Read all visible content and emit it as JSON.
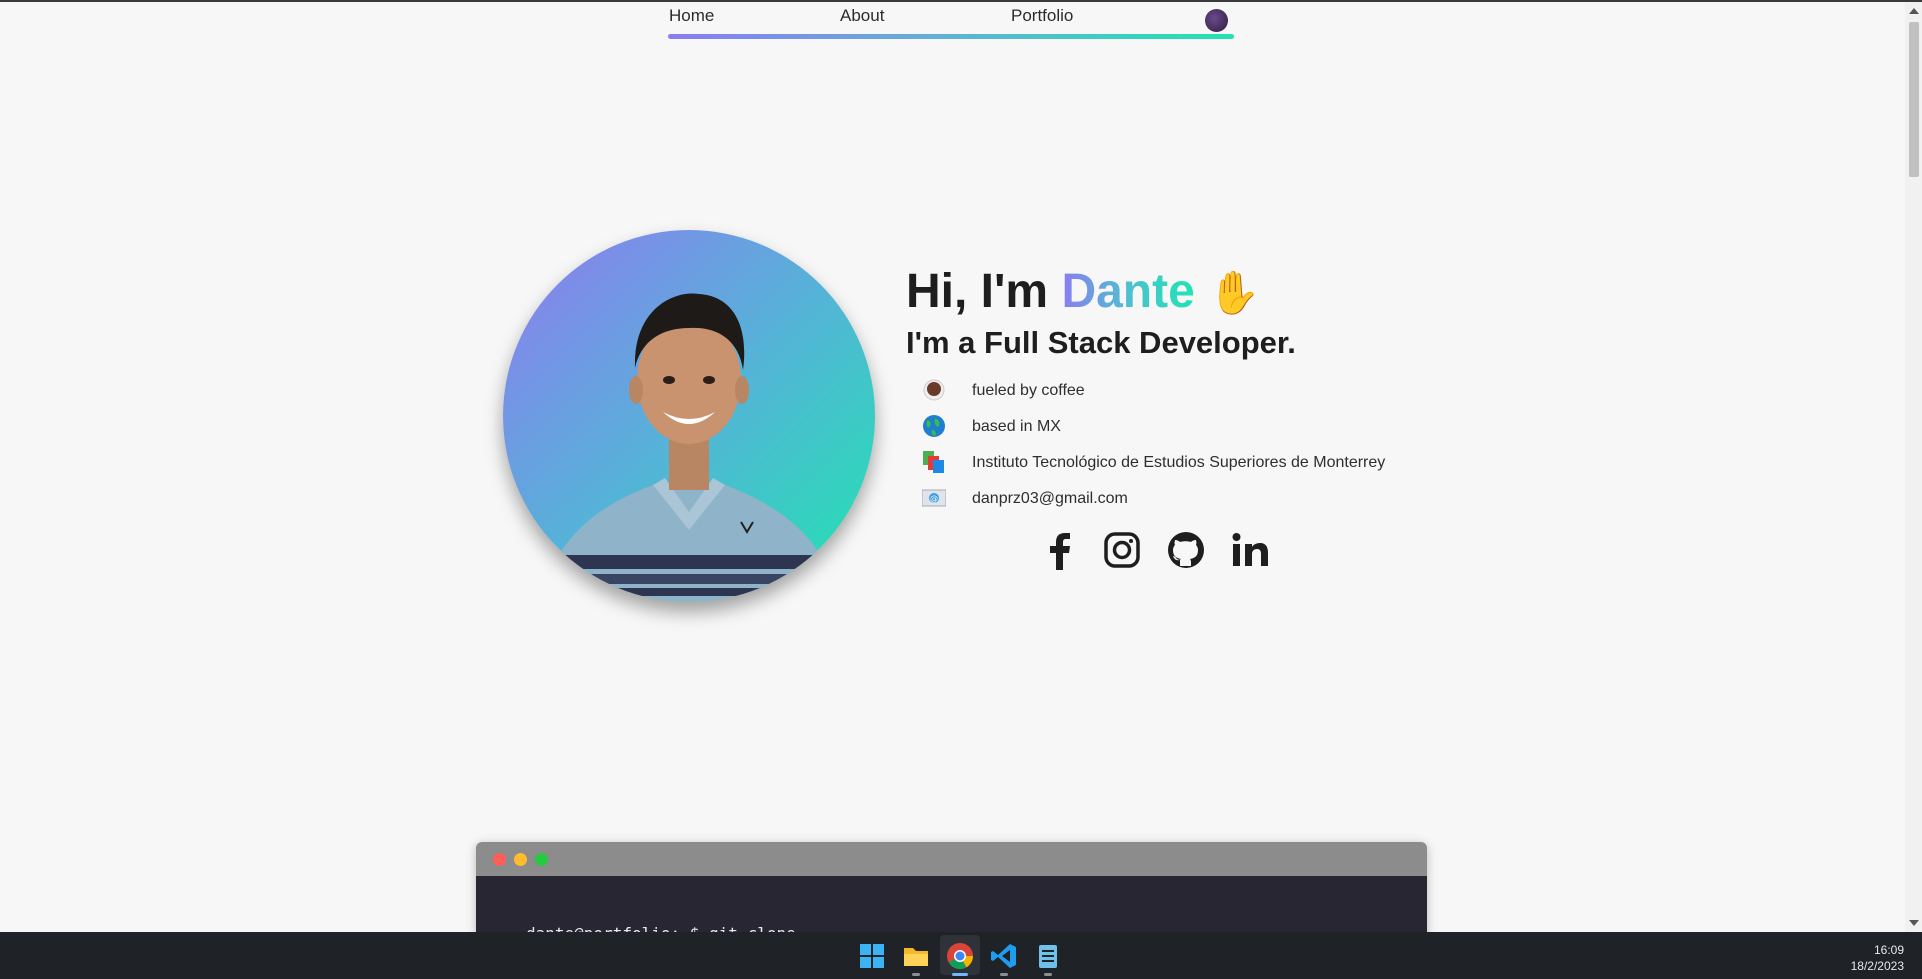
{
  "nav": {
    "items": [
      {
        "label": "Home"
      },
      {
        "label": "About"
      },
      {
        "label": "Portfolio"
      }
    ],
    "theme_toggle_icon": "theme-toggle-icon"
  },
  "hero": {
    "greeting": "Hi, I'm ",
    "name": "Dante",
    "wave": "✋",
    "role": "I'm a Full Stack Developer.",
    "facts": [
      {
        "icon": "coffee-icon",
        "text": "fueled by coffee"
      },
      {
        "icon": "globe-icon",
        "text": "based in MX"
      },
      {
        "icon": "books-icon",
        "text": "Instituto Tecnológico de Estudios Superiores de Monterrey"
      },
      {
        "icon": "email-icon",
        "text": "danprz03@gmail.com"
      }
    ],
    "socials": [
      "facebook-icon",
      "instagram-icon",
      "github-icon",
      "linkedin-icon"
    ]
  },
  "terminal": {
    "line": "dante@portfolio:~$ git clone"
  },
  "taskbar": {
    "apps": [
      "windows-start-icon",
      "file-explorer-icon",
      "chrome-icon",
      "vscode-icon",
      "notepad-icon"
    ],
    "time": "16:09",
    "date": "18/2/2023"
  },
  "colors": {
    "gradient_start": "#8b7cf0",
    "gradient_mid": "#56b2d8",
    "gradient_end": "#1fe5b0",
    "background": "#f7f7f7",
    "taskbar": "#1f2227"
  }
}
